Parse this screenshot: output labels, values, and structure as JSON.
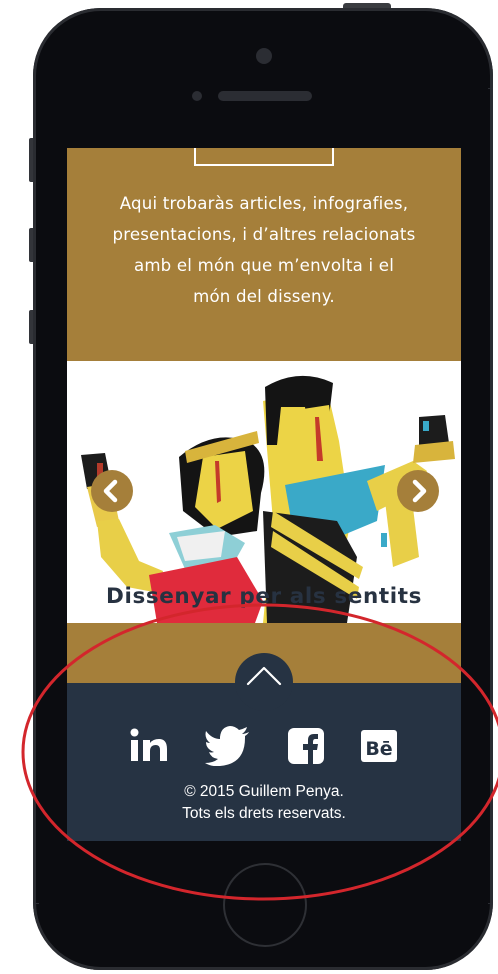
{
  "intro": {
    "lines": [
      "Aqui trobaràs articles, infografies,",
      "presentacions, i d’altres relacionats",
      "amb el món que m’envolta i el",
      "món del disseny."
    ]
  },
  "slider": {
    "caption": "Dissenyar per als sentits"
  },
  "footer": {
    "social": [
      "linkedin-icon",
      "twitter-icon",
      "facebook-icon",
      "behance-icon"
    ],
    "behance_text": "Bē",
    "linkedin_text": "in",
    "copyright_line1": "© 2015 Guillem Penya.",
    "copyright_line2": "Tots els drets reservats."
  },
  "colors": {
    "gold": "#a57f3a",
    "navy": "#263343",
    "annotation": "#d3262c"
  }
}
